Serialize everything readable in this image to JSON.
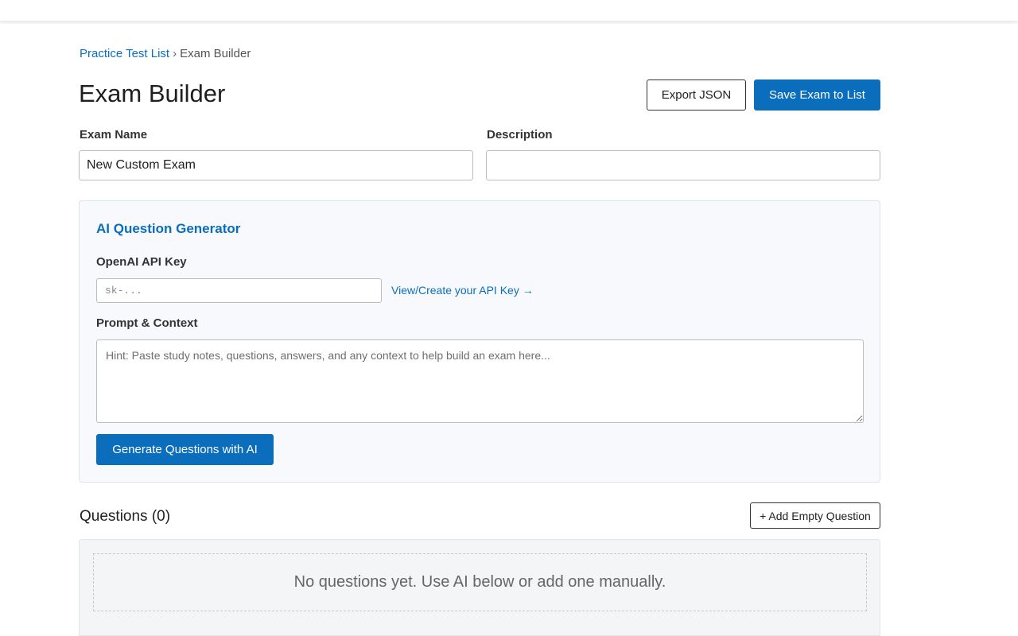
{
  "breadcrumb": {
    "parent": "Practice Test List",
    "separator": "›",
    "current": "Exam Builder"
  },
  "header": {
    "title": "Exam Builder",
    "export_label": "Export JSON",
    "save_label": "Save Exam to List"
  },
  "form": {
    "name_label": "Exam Name",
    "name_value": "New Custom Exam",
    "description_label": "Description",
    "description_value": ""
  },
  "ai_generator": {
    "title": "AI Question Generator",
    "api_key_label": "OpenAI API Key",
    "api_key_placeholder": "sk-...",
    "api_key_link": "View/Create your API Key →",
    "prompt_label": "Prompt & Context",
    "prompt_placeholder": "Hint: Paste study notes, questions, answers, and any context to help build an exam here...",
    "generate_label": "Generate Questions with AI"
  },
  "questions": {
    "title": "Questions (0)",
    "add_label": "+ Add Empty Question",
    "empty_message": "No questions yet. Use AI below or add one manually."
  },
  "colors": {
    "accent": "#0a6ebd",
    "panel_bg": "#f7f9fc"
  }
}
